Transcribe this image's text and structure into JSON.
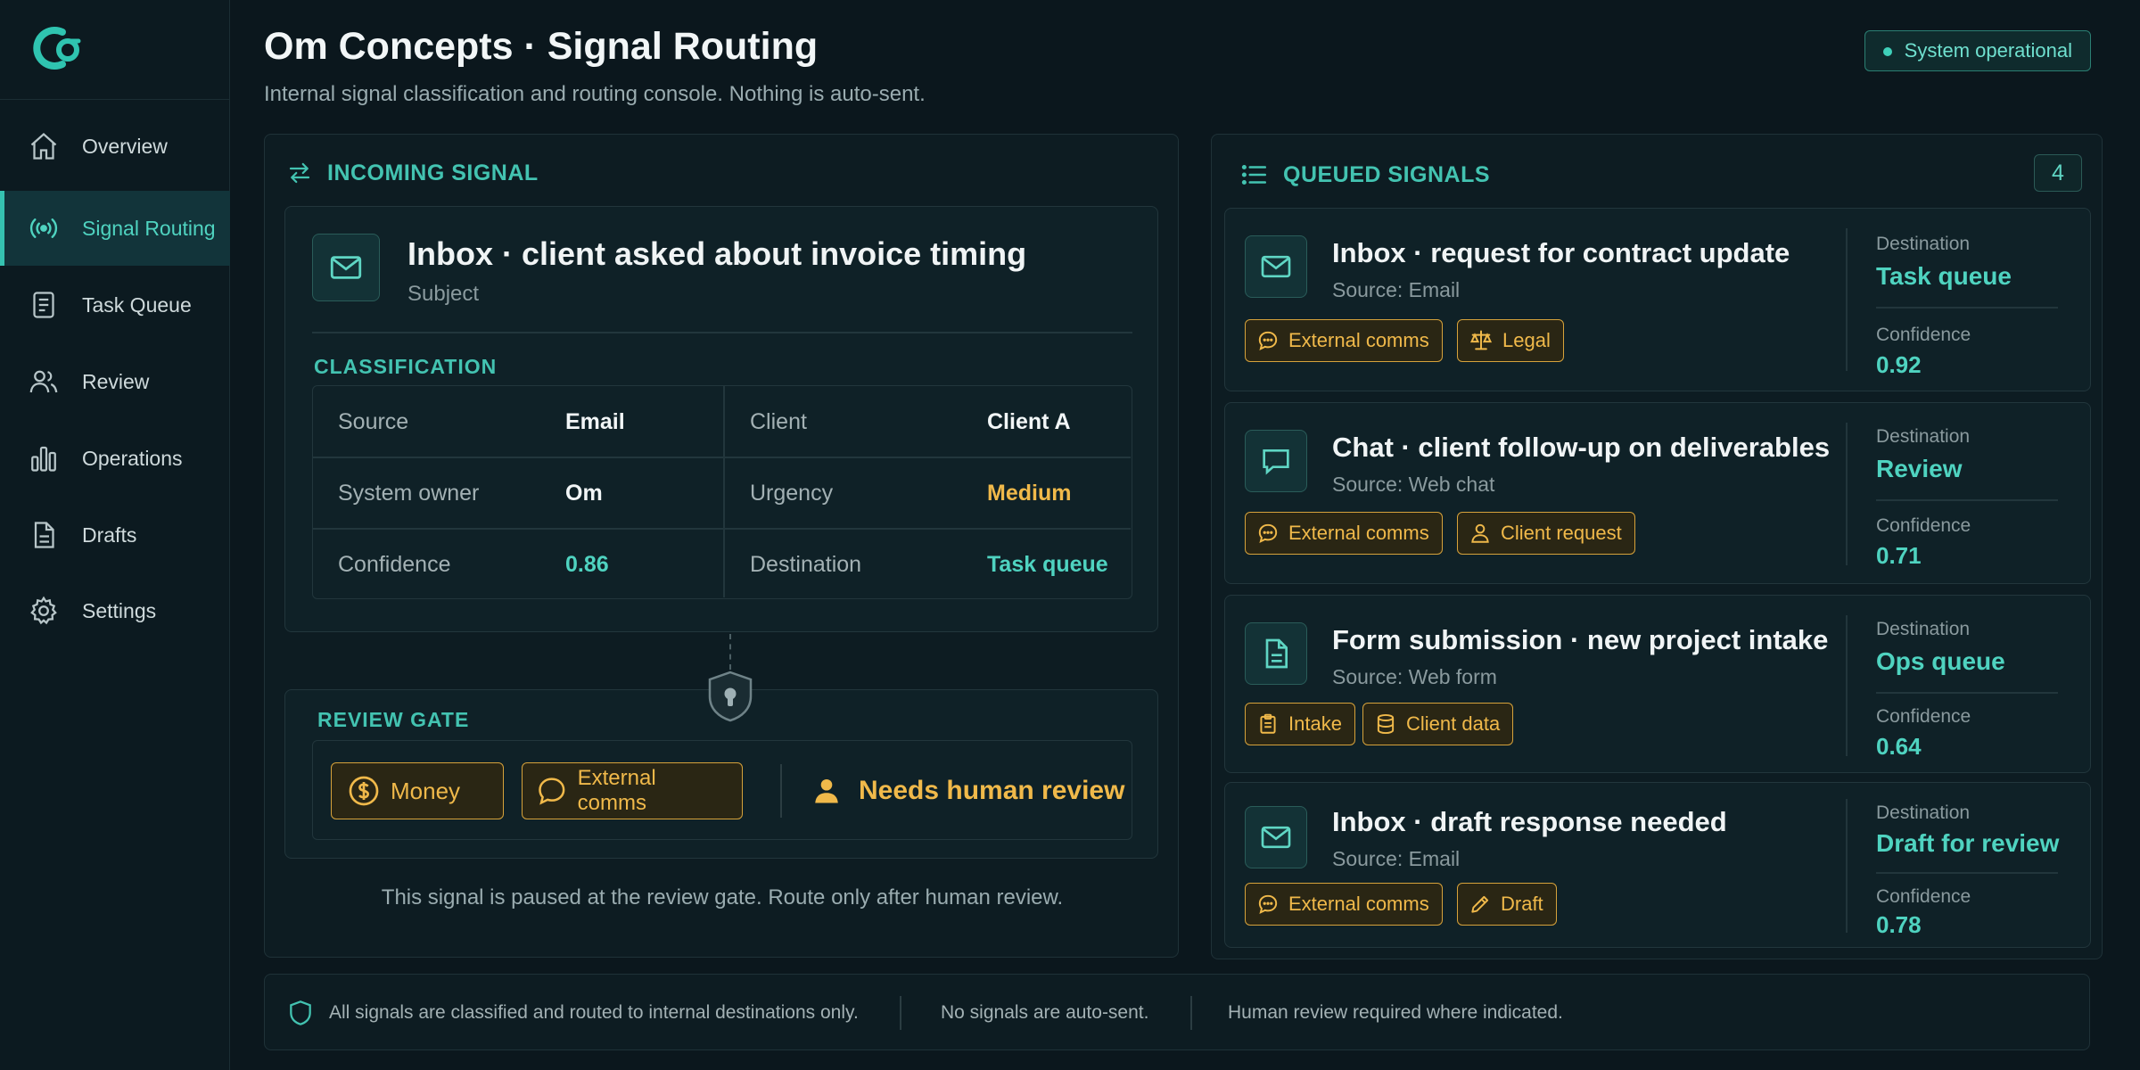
{
  "sidebar": {
    "items": [
      {
        "label": "Overview",
        "icon": "home-icon"
      },
      {
        "label": "Signal Routing",
        "icon": "signal-icon",
        "active": true
      },
      {
        "label": "Task Queue",
        "icon": "document-list-icon"
      },
      {
        "label": "Review",
        "icon": "users-icon"
      },
      {
        "label": "Operations",
        "icon": "bar-chart-icon"
      },
      {
        "label": "Drafts",
        "icon": "file-icon"
      },
      {
        "label": "Settings",
        "icon": "gear-icon"
      }
    ]
  },
  "header": {
    "title": "Om Concepts · Signal Routing",
    "subtitle": "Internal signal classification and routing console. Nothing is auto-sent.",
    "status": "System operational"
  },
  "incoming": {
    "heading": "INCOMING SIGNAL",
    "subject": "Inbox · client asked about invoice timing",
    "subject_label": "Subject",
    "classification_label": "CLASSIFICATION",
    "fields": {
      "source_k": "Source",
      "source_v": "Email",
      "client_k": "Client",
      "client_v": "Client A",
      "owner_k": "System owner",
      "owner_v": "Om",
      "urgency_k": "Urgency",
      "urgency_v": "Medium",
      "confidence_k": "Confidence",
      "confidence_v": "0.86",
      "destination_k": "Destination",
      "destination_v": "Task queue"
    },
    "review_gate_label": "REVIEW GATE",
    "gate_tags": [
      "Money",
      "External comms"
    ],
    "needs_review": "Needs human review",
    "paused_note": "This signal is paused at the review gate. Route only after human review."
  },
  "queued": {
    "heading": "QUEUED SIGNALS",
    "count": "4",
    "destination_label": "Destination",
    "confidence_label": "Confidence",
    "items": [
      {
        "title": "Inbox · request for contract update",
        "source": "Source: Email",
        "tags": [
          "External comms",
          "Legal"
        ],
        "destination": "Task queue",
        "confidence": "0.92"
      },
      {
        "title": "Chat · client follow-up on deliverables",
        "source": "Source: Web chat",
        "tags": [
          "External comms",
          "Client request"
        ],
        "destination": "Review",
        "confidence": "0.71"
      },
      {
        "title": "Form submission · new project intake",
        "source": "Source: Web form",
        "tags": [
          "Intake",
          "Client data"
        ],
        "destination": "Ops queue",
        "confidence": "0.64"
      },
      {
        "title": "Inbox · draft response needed",
        "source": "Source: Email",
        "tags": [
          "External comms",
          "Draft"
        ],
        "destination": "Draft for review",
        "confidence": "0.78"
      }
    ]
  },
  "footer": {
    "note1": "All signals are classified and routed to internal destinations only.",
    "note2": "No signals are auto-sent.",
    "note3": "Human review required where indicated."
  },
  "colors": {
    "accent": "#43c3b1",
    "warning": "#f0b94a",
    "background": "#0b171d"
  }
}
